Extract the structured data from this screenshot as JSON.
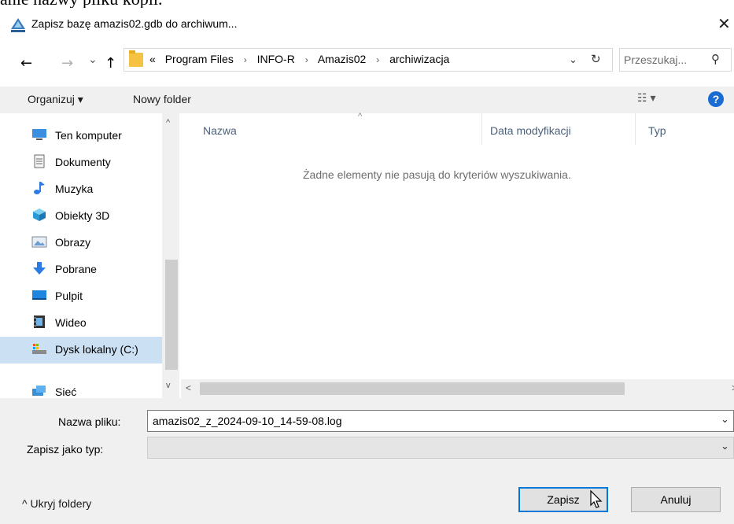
{
  "doc_fragment": "anie nazwy pliku kopii.",
  "window": {
    "title": "Zapisz bazę amazis02.gdb do archiwum...",
    "close_glyph": "✕",
    "app_icon": "amazis-app-icon"
  },
  "nav": {
    "back_glyph": "←",
    "forward_glyph": "→",
    "recent_glyph": "⌄",
    "up_glyph": "↑"
  },
  "address": {
    "overflow": "«",
    "crumbs": [
      "Program Files",
      "INFO-R",
      "Amazis02",
      "archiwizacja"
    ],
    "separator": "›",
    "dropdown_glyph": "⌄",
    "refresh_glyph": "↻"
  },
  "search": {
    "placeholder": "Przeszukaj...",
    "icon_glyph": "⚲"
  },
  "toolbar": {
    "organize": "Organizuj ▾",
    "new_folder": "Nowy folder",
    "view_glyph": "☷ ▾",
    "help": "?"
  },
  "sidebar": {
    "items": [
      {
        "label": "Ten komputer",
        "icon": "computer-icon"
      },
      {
        "label": "Dokumenty",
        "icon": "documents-icon"
      },
      {
        "label": "Muzyka",
        "icon": "music-icon"
      },
      {
        "label": "Obiekty 3D",
        "icon": "objects-3d-icon"
      },
      {
        "label": "Obrazy",
        "icon": "pictures-icon"
      },
      {
        "label": "Pobrane",
        "icon": "downloads-icon"
      },
      {
        "label": "Pulpit",
        "icon": "desktop-icon"
      },
      {
        "label": "Wideo",
        "icon": "video-icon"
      },
      {
        "label": "Dysk lokalny (C:)",
        "icon": "drive-icon"
      },
      {
        "label": "Sieć",
        "icon": "network-icon"
      }
    ],
    "selected_index": 8
  },
  "list": {
    "columns": [
      "Nazwa",
      "Data modyfikacji",
      "Typ"
    ],
    "sort_glyph": "^",
    "empty_message": "Żadne elementy nie pasują do kryteriów wyszukiwania."
  },
  "scroll": {
    "up": "^",
    "down": "v",
    "left": "<",
    "right": ">"
  },
  "form": {
    "filename_label": "Nazwa pliku:",
    "filename_value": "amazis02_z_2024-09-10_14-59-08.log",
    "type_label": "Zapisz jako typ:",
    "type_value": "",
    "dropdown_glyph": "⌄"
  },
  "footer": {
    "hide_folders": "^  Ukryj foldery",
    "save": "Zapisz",
    "cancel": "Anuluj"
  },
  "colors": {
    "accent": "#0078d7",
    "selection": "#cce0f3",
    "help": "#1a6cd3",
    "folder": "#f5c243"
  }
}
